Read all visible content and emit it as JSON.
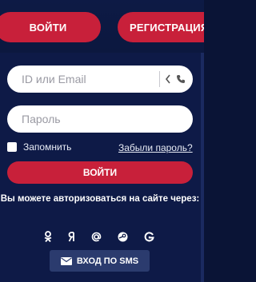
{
  "header": {
    "login_label": "ВОЙТИ",
    "register_label": "РЕГИСТРАЦИЯ"
  },
  "form": {
    "id_placeholder": "ID или Email",
    "password_placeholder": "Пароль",
    "remember_label": "Запомнить",
    "forgot_label": "Забыли пароль?",
    "submit_label": "ВОЙТИ"
  },
  "social": {
    "caption": "Вы можете авторизоваться на сайте через:",
    "icons": [
      "odnoklassniki-icon",
      "yandex-icon",
      "mailru-icon",
      "steam-icon",
      "google-icon"
    ],
    "sms_label": "ВХОД ПО SMS"
  },
  "colors": {
    "accent": "#c8203a",
    "panel": "#0e1a47",
    "sms_button": "#2b3b6e"
  }
}
